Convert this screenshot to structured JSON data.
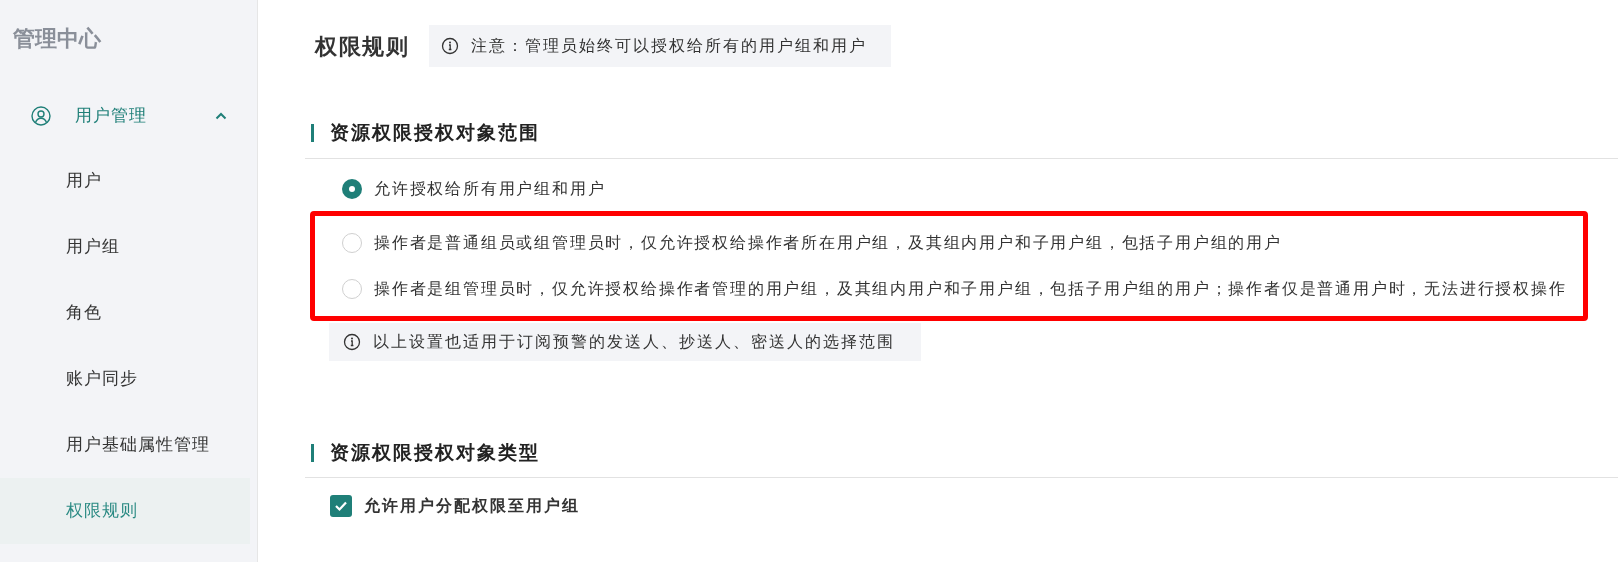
{
  "sidebar": {
    "title": "管理中心",
    "group": {
      "label": "用户管理",
      "expanded": true,
      "items": [
        {
          "label": "用户",
          "selected": false
        },
        {
          "label": "用户组",
          "selected": false
        },
        {
          "label": "角色",
          "selected": false
        },
        {
          "label": "账户同步",
          "selected": false
        },
        {
          "label": "用户基础属性管理",
          "selected": false
        },
        {
          "label": "权限规则",
          "selected": true
        }
      ]
    }
  },
  "page": {
    "title": "权限规则",
    "notice": "注意：管理员始终可以授权给所有的用户组和用户"
  },
  "scope_section": {
    "heading": "资源权限授权对象范围",
    "options": [
      {
        "label": "允许授权给所有用户组和用户",
        "selected": true,
        "highlighted": false
      },
      {
        "label": "操作者是普通组员或组管理员时，仅允许授权给操作者所在用户组，及其组内用户和子用户组，包括子用户组的用户",
        "selected": false,
        "highlighted": true
      },
      {
        "label": "操作者是组管理员时，仅允许授权给操作者管理的用户组，及其组内用户和子用户组，包括子用户组的用户；操作者仅是普通用户时，无法进行授权操作",
        "selected": false,
        "highlighted": true
      }
    ],
    "note": "以上设置也适用于订阅预警的发送人、抄送人、密送人的选择范围"
  },
  "type_section": {
    "heading": "资源权限授权对象类型",
    "checkbox": {
      "label": "允许用户分配权限至用户组",
      "checked": true
    }
  }
}
